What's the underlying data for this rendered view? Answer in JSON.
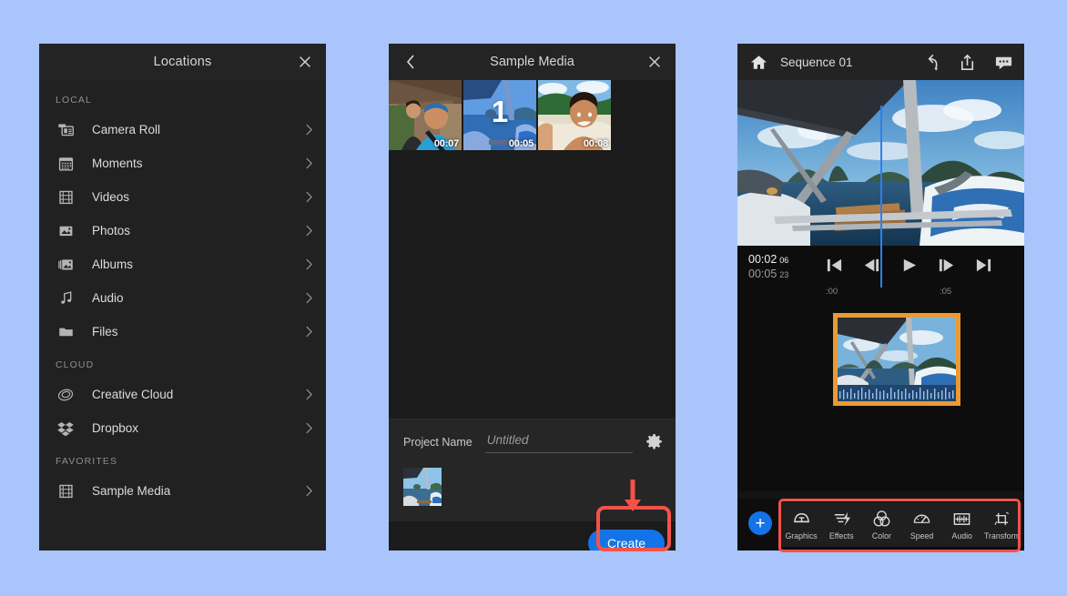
{
  "background_color": "#aac4fc",
  "locations_panel": {
    "title": "Locations",
    "close_icon": "close-icon",
    "groups": [
      {
        "label": "LOCAL",
        "items": [
          {
            "label": "Camera Roll",
            "icon": "camera-roll-icon"
          },
          {
            "label": "Moments",
            "icon": "calendar-icon"
          },
          {
            "label": "Videos",
            "icon": "film-strip-icon"
          },
          {
            "label": "Photos",
            "icon": "photo-icon"
          },
          {
            "label": "Albums",
            "icon": "albums-icon"
          },
          {
            "label": "Audio",
            "icon": "music-note-icon"
          },
          {
            "label": "Files",
            "icon": "folder-icon"
          }
        ]
      },
      {
        "label": "CLOUD",
        "items": [
          {
            "label": "Creative Cloud",
            "icon": "creative-cloud-icon"
          },
          {
            "label": "Dropbox",
            "icon": "dropbox-icon"
          }
        ]
      },
      {
        "label": "FAVORITES",
        "items": [
          {
            "label": "Sample Media",
            "icon": "film-strip-icon"
          }
        ]
      }
    ]
  },
  "media_panel": {
    "title": "Sample Media",
    "back_icon": "chevron-left-icon",
    "close_icon": "close-icon",
    "thumbnails": [
      {
        "duration": "00:07",
        "selected": false,
        "badge": "",
        "scene": "two-people-porch"
      },
      {
        "duration": "00:05",
        "selected": true,
        "badge": "1",
        "scene": "boat-sea"
      },
      {
        "duration": "00:08",
        "selected": false,
        "badge": "",
        "scene": "man-beach"
      }
    ],
    "project_name_label": "Project Name",
    "project_name_value": "",
    "project_name_placeholder": "Untitled",
    "settings_icon": "gear-icon",
    "create_button": "Create",
    "create_button_color": "#1473e6",
    "annotation_color": "#f4524a"
  },
  "editor_panel": {
    "home_icon": "home-icon",
    "sequence_title": "Sequence 01",
    "header_icons": [
      "undo-icon",
      "share-icon",
      "comment-icon"
    ],
    "timecode_current": "00:02",
    "timecode_current_frames": "06",
    "timecode_total": "00:05",
    "timecode_total_frames": "23",
    "transport_buttons": [
      "skip-to-start-icon",
      "step-back-icon",
      "play-icon",
      "step-forward-icon",
      "skip-to-end-icon"
    ],
    "ruler_ticks": [
      ":00",
      ":05"
    ],
    "clip_border_color": "#eb9a32",
    "playhead_color": "#2f7fe8",
    "add_button": "+",
    "tools": [
      {
        "label": "Graphics",
        "icon": "graphics-icon"
      },
      {
        "label": "Effects",
        "icon": "effects-icon"
      },
      {
        "label": "Color",
        "icon": "color-icon"
      },
      {
        "label": "Speed",
        "icon": "speed-icon"
      },
      {
        "label": "Audio",
        "icon": "audio-icon"
      },
      {
        "label": "Transform",
        "icon": "transform-icon"
      }
    ]
  }
}
